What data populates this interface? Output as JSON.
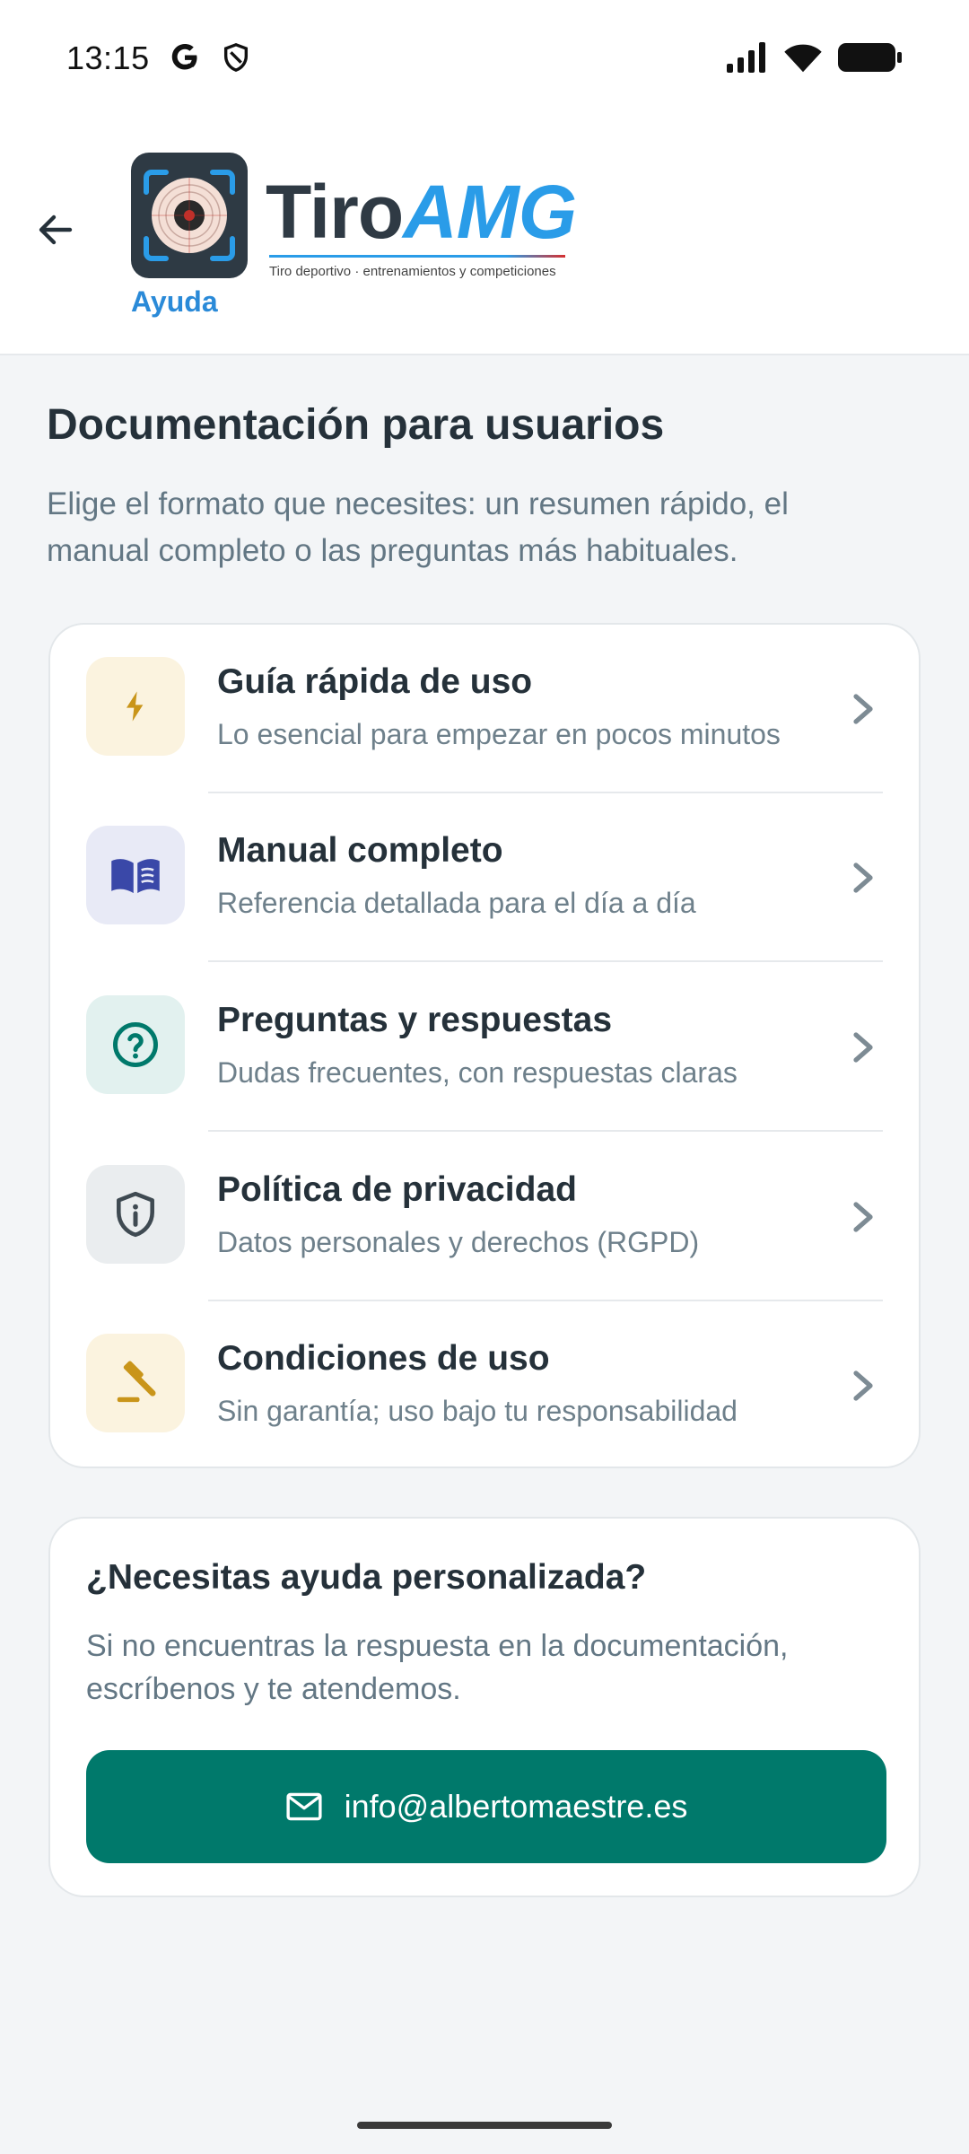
{
  "status_bar": {
    "time": "13:15",
    "left_icons": [
      "google-icon",
      "shield-icon"
    ],
    "right_icons": [
      "signal-icon",
      "wifi-icon",
      "battery-icon"
    ]
  },
  "header": {
    "back_icon": "arrow-left-icon",
    "brand_tiro": "Tiro",
    "brand_amg": "AMG",
    "brand_tagline": "Tiro deportivo · entrenamientos y competiciones",
    "subtitle": "Ayuda"
  },
  "main": {
    "title": "Documentación para usuarios",
    "intro": "Elige el formato que necesites: un resumen rápido, el manual completo o las preguntas más habituales."
  },
  "docs": [
    {
      "title": "Guía rápida de uso",
      "subtitle": "Lo esencial para empezar en pocos minutos",
      "icon": "bolt-icon",
      "icon_color": "#c9951a",
      "tile_color": "#fbf3df"
    },
    {
      "title": "Manual completo",
      "subtitle": "Referencia detallada para el día a día",
      "icon": "book-icon",
      "icon_color": "#3a48a8",
      "tile_color": "#e8eaf6"
    },
    {
      "title": "Preguntas y respuestas",
      "subtitle": "Dudas frecuentes, con respuestas claras",
      "icon": "question-circle-icon",
      "icon_color": "#00796b",
      "tile_color": "#e2f1ef"
    },
    {
      "title": "Política de privacidad",
      "subtitle": "Datos personales y derechos (RGPD)",
      "icon": "shield-info-icon",
      "icon_color": "#3f4a52",
      "tile_color": "#eaedef"
    },
    {
      "title": "Condiciones de uso",
      "subtitle": "Sin garantía; uso bajo tu responsabilidad",
      "icon": "gavel-icon",
      "icon_color": "#c9951a",
      "tile_color": "#fbf3df"
    }
  ],
  "help": {
    "title": "¿Necesitas ayuda personalizada?",
    "text": "Si no encuentras la respuesta en la documentación, escríbenos y te atendemos.",
    "email": "info@albertomaestre.es",
    "button_color": "#00796b"
  }
}
